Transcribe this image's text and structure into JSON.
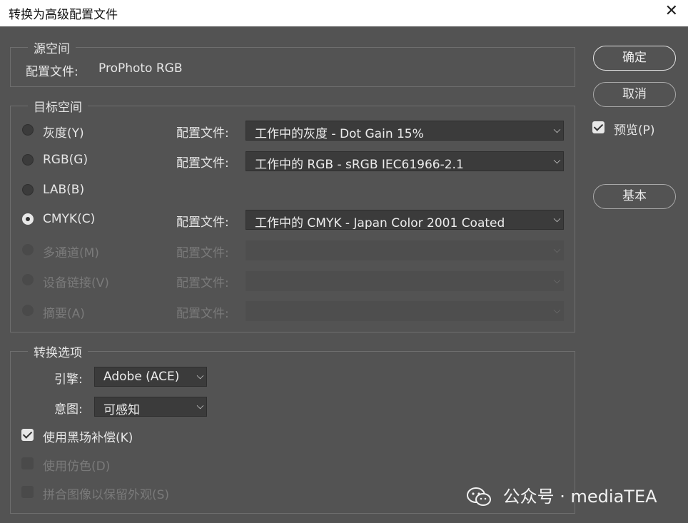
{
  "window": {
    "title": "转换为高级配置文件",
    "close_glyph": "✕"
  },
  "source": {
    "legend": "源空间",
    "profile_label": "配置文件:",
    "profile_value": "ProPhoto RGB"
  },
  "target": {
    "legend": "目标空间",
    "rows": [
      {
        "label": "灰度(Y)",
        "profile_label": "配置文件:",
        "profile_value": "工作中的灰度 - Dot Gain 15%",
        "selected": false,
        "enabled": true
      },
      {
        "label": "RGB(G)",
        "profile_label": "配置文件:",
        "profile_value": "工作中的 RGB - sRGB IEC61966-2.1",
        "selected": false,
        "enabled": true
      },
      {
        "label": "LAB(B)",
        "selected": false,
        "enabled": true
      },
      {
        "label": "CMYK(C)",
        "profile_label": "配置文件:",
        "profile_value": "工作中的 CMYK - Japan Color 2001 Coated",
        "selected": true,
        "enabled": true
      },
      {
        "label": "多通道(M)",
        "profile_label": "配置文件:",
        "profile_value": "",
        "selected": false,
        "enabled": false
      },
      {
        "label": "设备链接(V)",
        "profile_label": "配置文件:",
        "profile_value": "",
        "selected": false,
        "enabled": false
      },
      {
        "label": "摘要(A)",
        "profile_label": "配置文件:",
        "profile_value": "",
        "selected": false,
        "enabled": false
      }
    ]
  },
  "options": {
    "legend": "转换选项",
    "engine_label": "引擎:",
    "engine_value": "Adobe (ACE)",
    "intent_label": "意图:",
    "intent_value": "可感知",
    "black_point": {
      "label": "使用黑场补偿(K)",
      "checked": true,
      "enabled": true
    },
    "dither": {
      "label": "使用仿色(D)",
      "checked": false,
      "enabled": false
    },
    "flatten": {
      "label": "拼合图像以保留外观(S)",
      "checked": false,
      "enabled": false
    }
  },
  "buttons": {
    "ok": "确定",
    "cancel": "取消",
    "basic": "基本"
  },
  "preview": {
    "label": "预览(P)",
    "checked": true
  },
  "watermark": {
    "text": "公众号 · mediaTEA",
    "icon": "wechat-icon"
  },
  "colors": {
    "dialog_bg": "#535353",
    "field_bg": "#3b3b3b",
    "titlebar_bg": "#ffffff"
  }
}
